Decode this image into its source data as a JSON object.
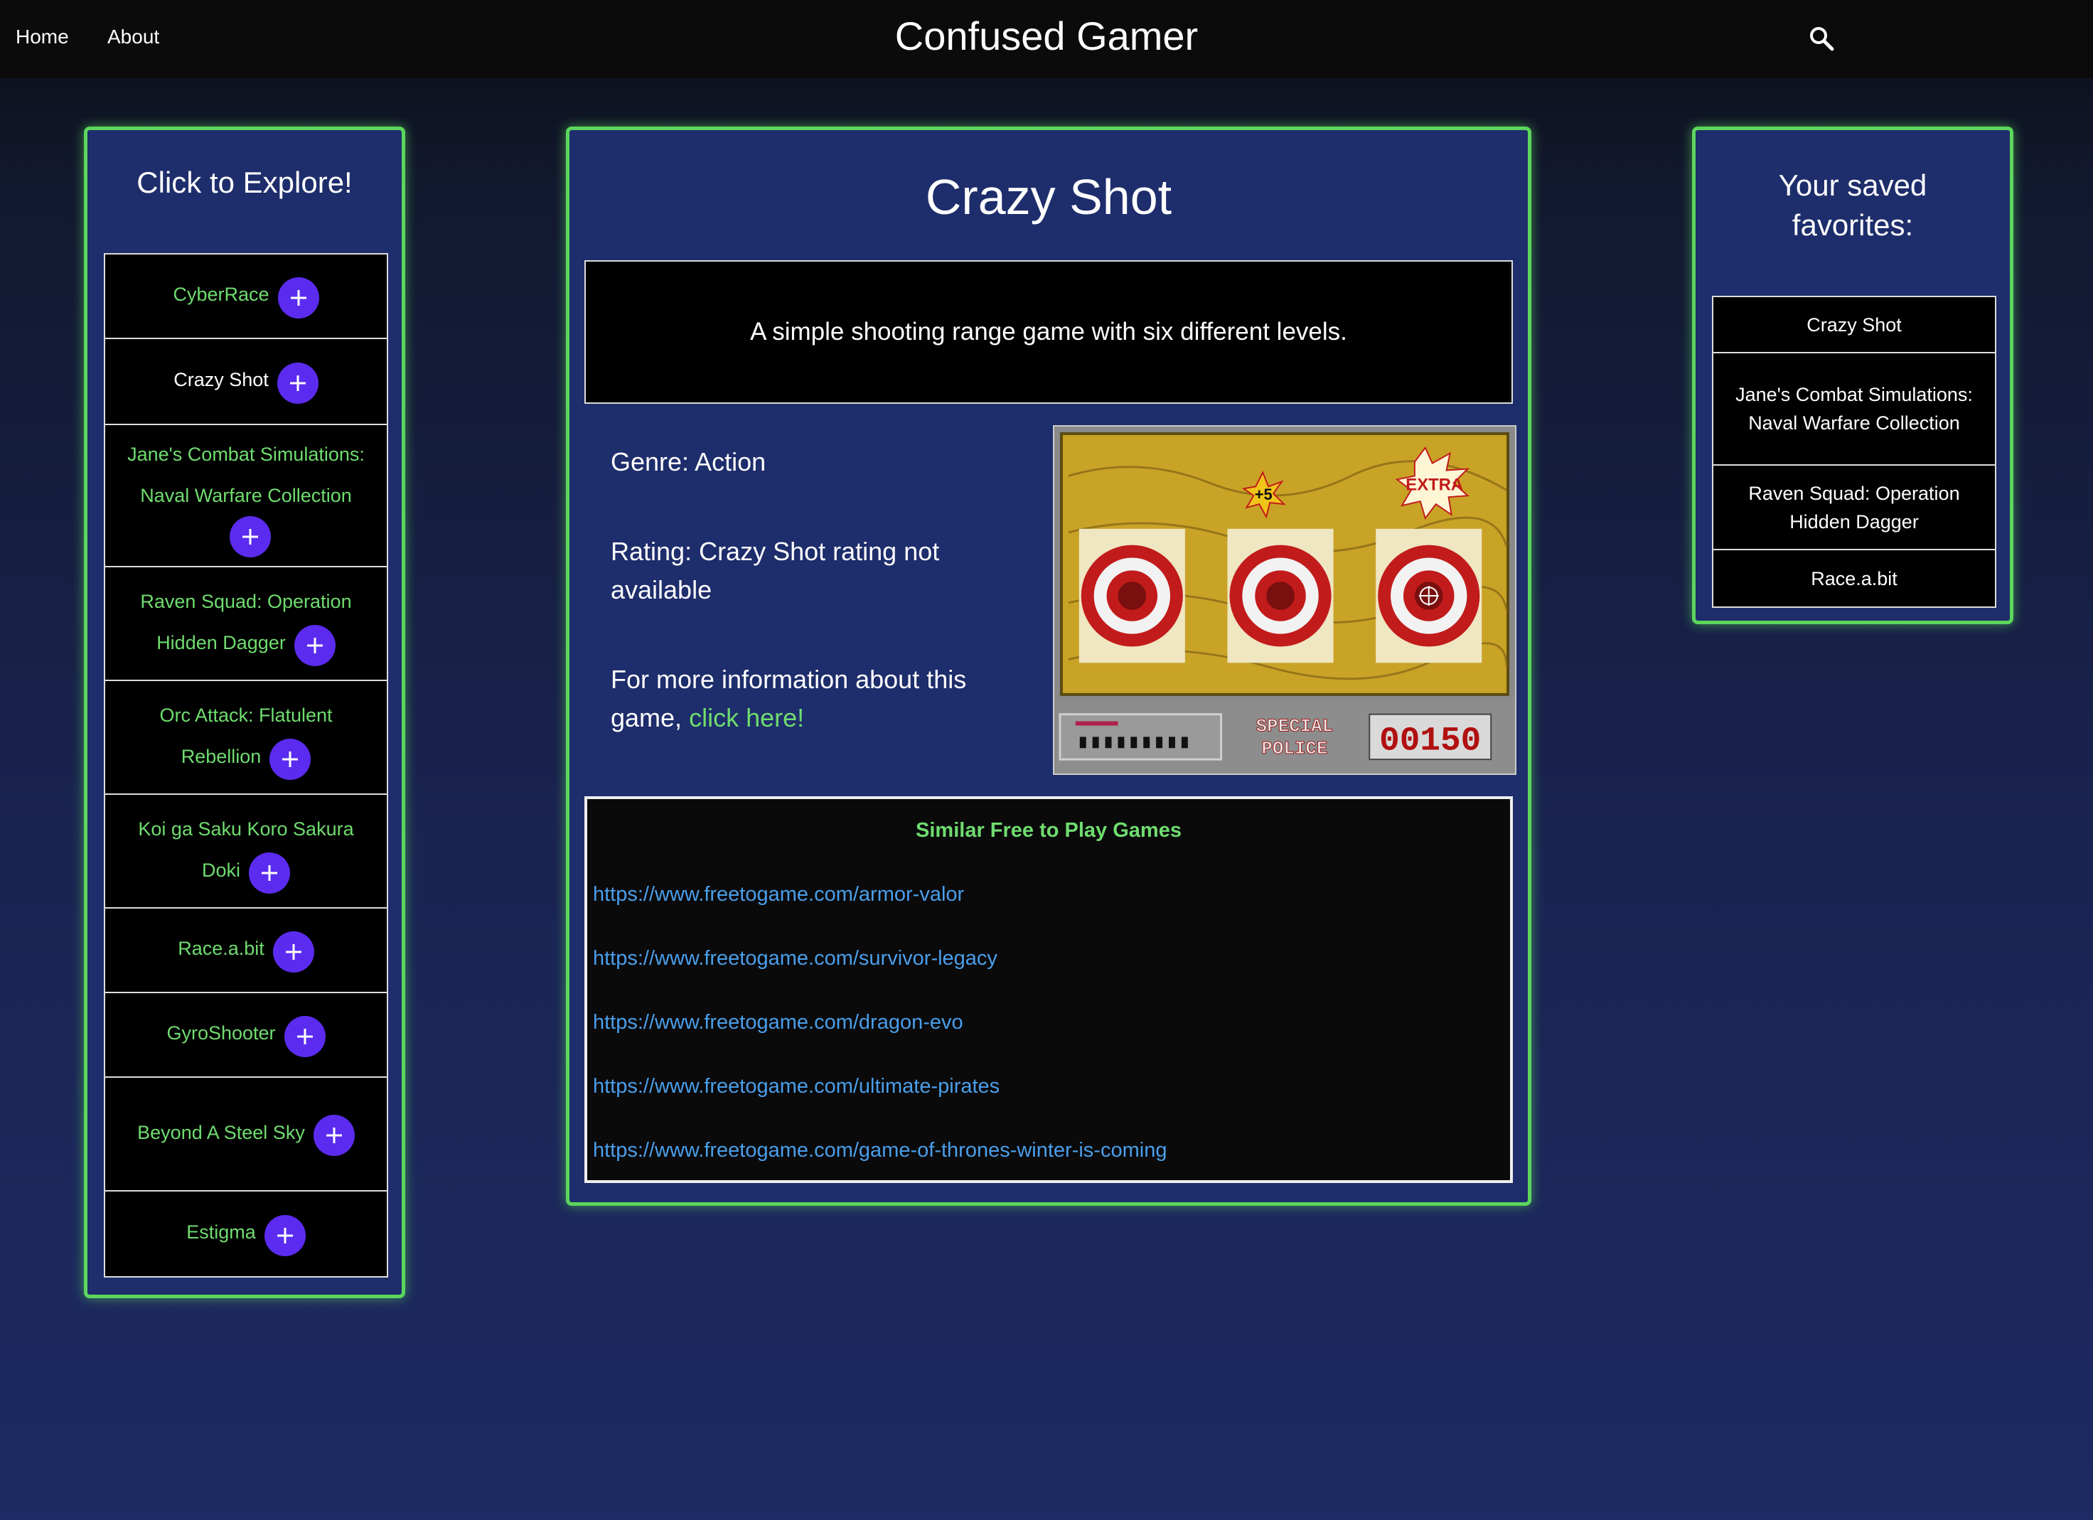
{
  "nav": {
    "home": "Home",
    "about": "About",
    "brand": "Confused Gamer",
    "search_icon": "search-icon"
  },
  "explore": {
    "title": "Click to Explore!",
    "items": [
      {
        "label": "CyberRace",
        "active": false
      },
      {
        "label": "Crazy Shot",
        "active": true
      },
      {
        "label": "Jane's Combat Simulations: Naval Warfare Collection",
        "active": false
      },
      {
        "label": "Raven Squad: Operation Hidden Dagger",
        "active": false
      },
      {
        "label": "Orc Attack: Flatulent Rebellion",
        "active": false
      },
      {
        "label": "Koi ga Saku Koro Sakura Doki",
        "active": false
      },
      {
        "label": "Race.a.bit",
        "active": false
      },
      {
        "label": "GyroShooter",
        "active": false
      },
      {
        "label": "Beyond A Steel Sky",
        "active": false
      },
      {
        "label": "Estigma",
        "active": false
      }
    ]
  },
  "game": {
    "title": "Crazy Shot",
    "description": "A simple shooting range game with six different levels.",
    "genre": "Genre: Action",
    "rating": "Rating: Crazy Shot rating not available",
    "more_info_prefix": "For more information about this game,",
    "more_info_link": "click here!",
    "screenshot": {
      "badge_plus": "+5",
      "badge_extra": "EXTRA",
      "special_label_1": "SPECIAL",
      "special_label_2": "POLICE",
      "score": "00150"
    }
  },
  "similar": {
    "title": "Similar Free to Play Games",
    "links": [
      "https://www.freetogame.com/armor-valor",
      "https://www.freetogame.com/survivor-legacy",
      "https://www.freetogame.com/dragon-evo",
      "https://www.freetogame.com/ultimate-pirates",
      "https://www.freetogame.com/game-of-thrones-winter-is-coming"
    ]
  },
  "favorites": {
    "title": "Your saved favorites:",
    "items": [
      "Crazy Shot",
      "Jane's Combat Simulations: Naval Warfare Collection",
      "Raven Squad: Operation Hidden Dagger",
      "Race.a.bit"
    ]
  },
  "colors": {
    "accent_green": "#5cd65c",
    "link_green": "#6fdc6f",
    "add_button": "#5b2cf0",
    "link_blue": "#4a9eea",
    "panel_bg": "#1e2d6b"
  }
}
